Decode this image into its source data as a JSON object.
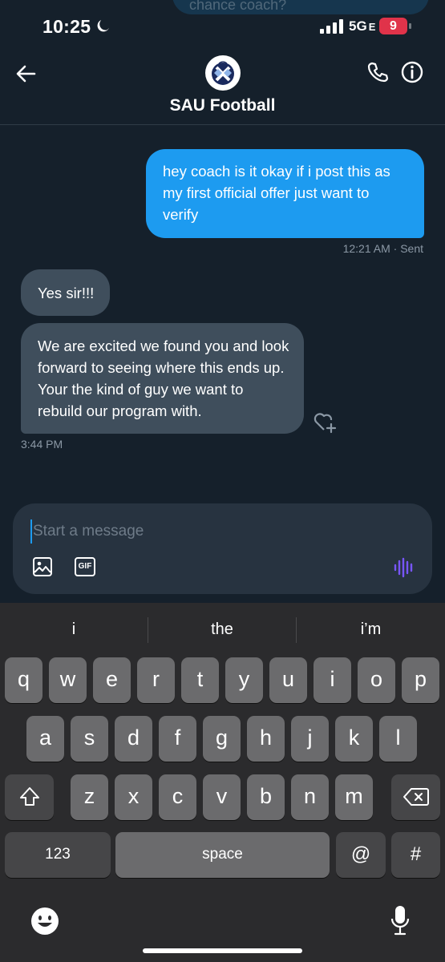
{
  "status": {
    "time": "10:25",
    "network": "5G",
    "network_suffix": "E",
    "battery": "9",
    "prev_message_fragment": "chance coach?"
  },
  "header": {
    "title": "SAU Football",
    "avatar_text": "ST. ANDREWS FOOTBALL"
  },
  "messages": {
    "outgoing": {
      "text": "hey coach is it okay if i post this as my first official offer just want to verify",
      "time": "12:21 AM",
      "status": "· Sent"
    },
    "incoming1": {
      "text": "Yes sir!!!"
    },
    "incoming2": {
      "text": "We are excited we found you and look forward to seeing where this ends up. Your the kind of guy we want to rebuild our program with.",
      "time": "3:44 PM"
    }
  },
  "composer": {
    "placeholder": "Start a message",
    "gif_label": "GIF"
  },
  "keyboard": {
    "suggestions": [
      "i",
      "the",
      "i’m"
    ],
    "row1": [
      "q",
      "w",
      "e",
      "r",
      "t",
      "y",
      "u",
      "i",
      "o",
      "p"
    ],
    "row2": [
      "a",
      "s",
      "d",
      "f",
      "g",
      "h",
      "j",
      "k",
      "l"
    ],
    "row3": [
      "z",
      "x",
      "c",
      "v",
      "b",
      "n",
      "m"
    ],
    "numbers_label": "123",
    "space_label": "space",
    "at_label": "@",
    "hash_label": "#"
  },
  "colors": {
    "background": "#15202b",
    "accent": "#1d9bf0",
    "incoming_bubble": "#3f4e5c",
    "voice_icon": "#7856ff"
  },
  "icons": [
    "back-arrow-icon",
    "phone-icon",
    "info-icon",
    "moon-icon",
    "signal-icon",
    "react-heart-plus-icon",
    "image-icon",
    "gif-icon",
    "voice-waveform-icon",
    "shift-icon",
    "backspace-icon",
    "emoji-icon",
    "microphone-icon"
  ]
}
